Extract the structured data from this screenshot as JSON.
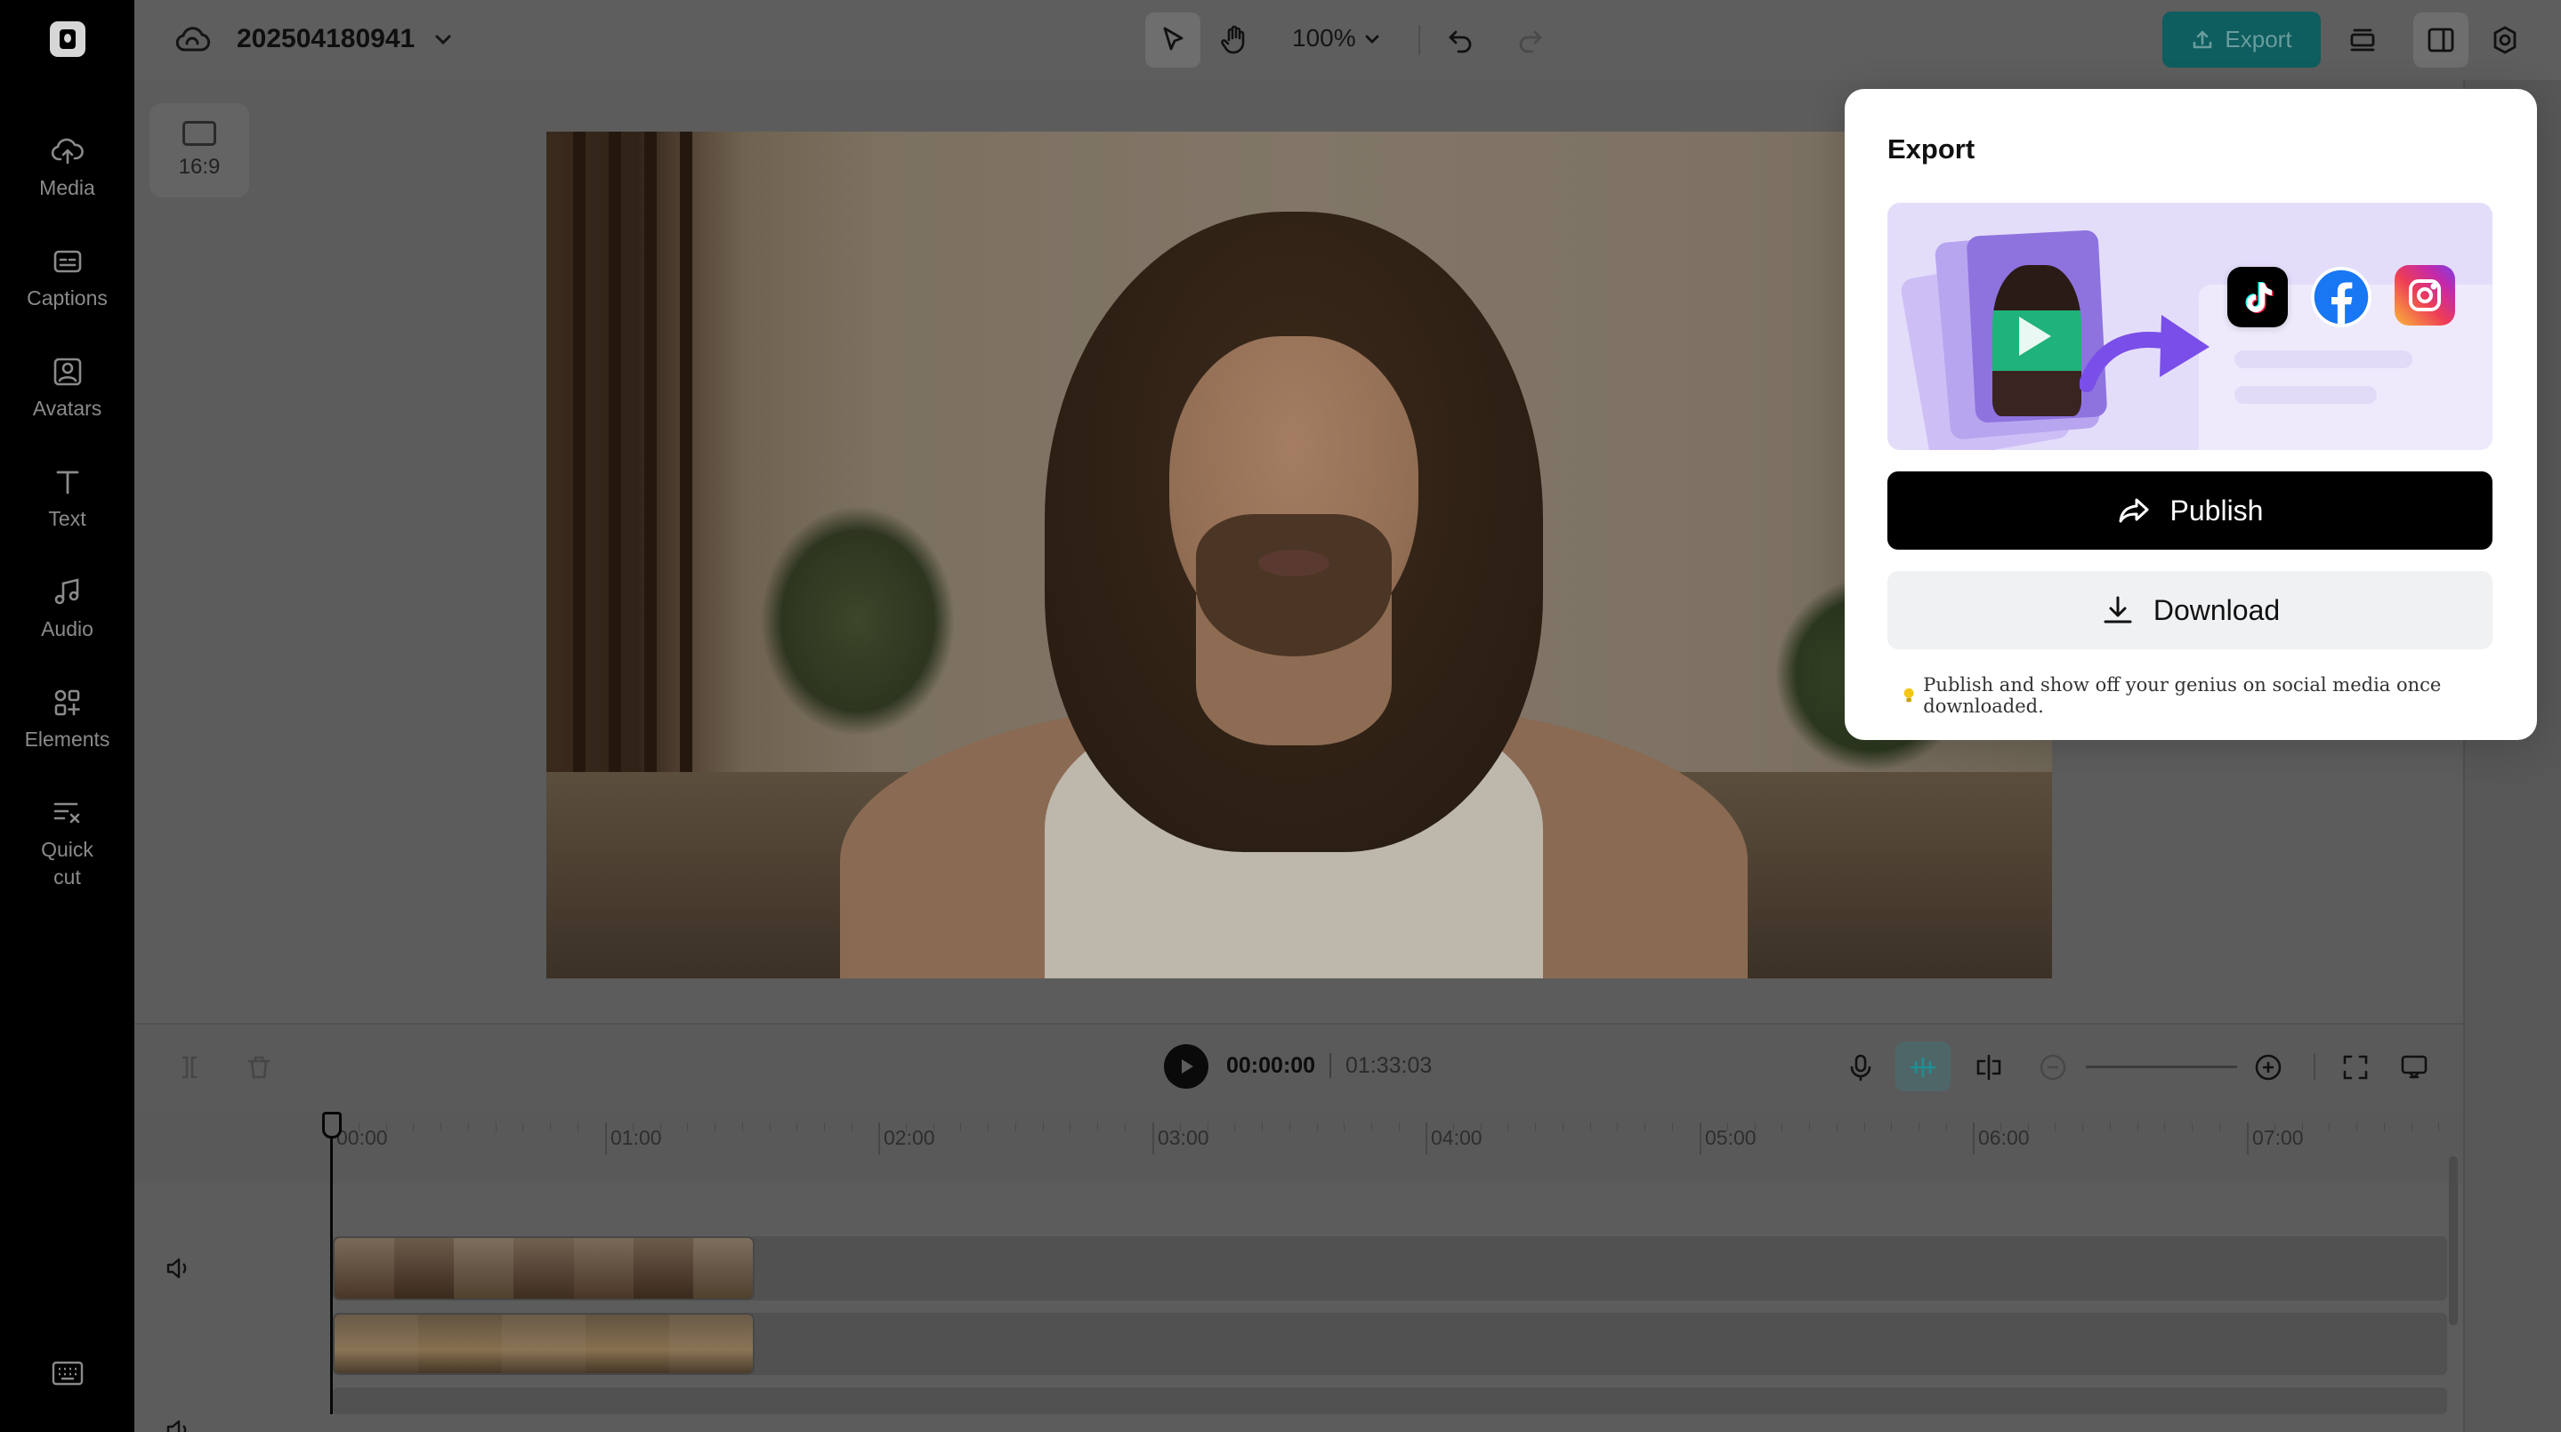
{
  "sidebar": {
    "items": [
      {
        "label": "Media",
        "icon": "cloud-upload-icon"
      },
      {
        "label": "Captions",
        "icon": "captions-icon"
      },
      {
        "label": "Avatars",
        "icon": "avatar-icon"
      },
      {
        "label": "Text",
        "icon": "text-icon"
      },
      {
        "label": "Audio",
        "icon": "music-note-icon"
      },
      {
        "label": "Elements",
        "icon": "elements-icon"
      },
      {
        "label": "Quick cut",
        "icon": "quick-cut-icon"
      }
    ]
  },
  "header": {
    "project_title": "202504180941",
    "zoom": "100%",
    "export_label": "Export"
  },
  "canvas": {
    "aspect_ratio": "16:9"
  },
  "timeline": {
    "current_time": "00:00:00",
    "total_time": "01:33:03",
    "ticks": [
      "00:00",
      "01:00",
      "02:00",
      "03:00",
      "04:00",
      "05:00",
      "06:00",
      "07:00"
    ]
  },
  "export_panel": {
    "title": "Export",
    "publish_label": "Publish",
    "download_label": "Download",
    "hint": "Publish and show off your genius on social media once downloaded."
  },
  "colors": {
    "accent": "#0e5d5f",
    "publish_bg": "#000000",
    "download_bg": "#f0f1f3",
    "banner_bg": "#e4ddfa"
  }
}
